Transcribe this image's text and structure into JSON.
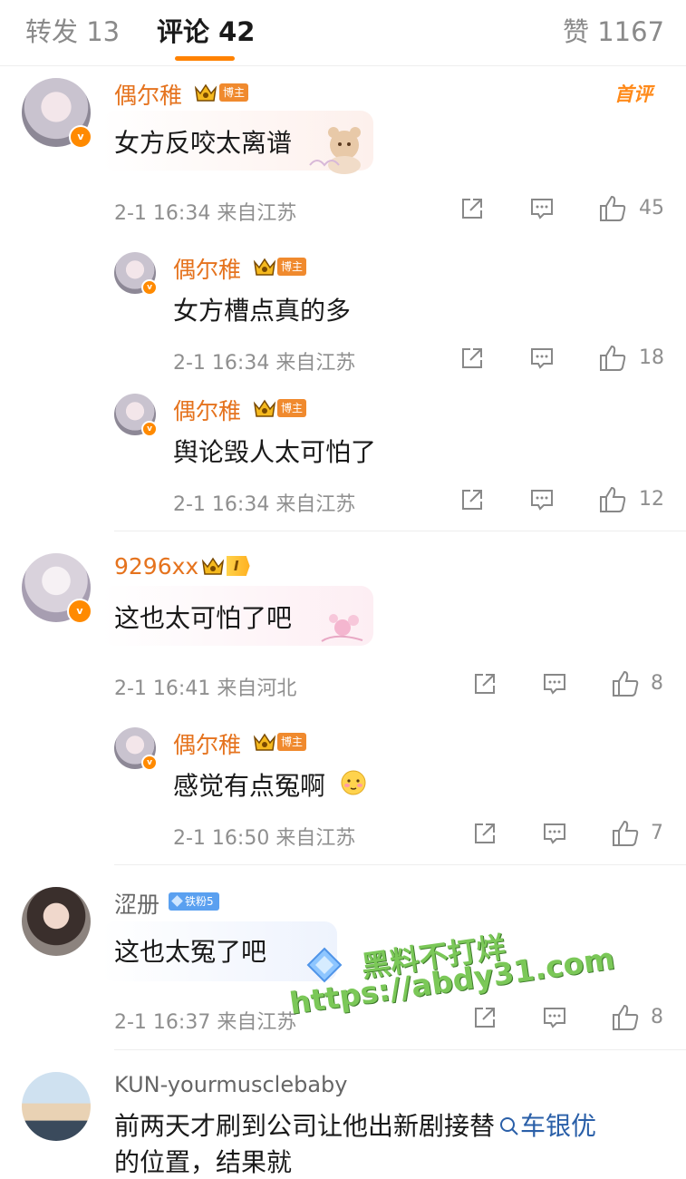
{
  "tabs": {
    "repost": "转发 13",
    "comments": "评论 42",
    "likes": "赞 1167"
  },
  "first_comment_badge": "首评",
  "comments": [
    {
      "user": "偶尔稚",
      "role": "博主",
      "text": "女方反咬太离谱",
      "time": "2-1 16:34 来自江苏",
      "likes": "45",
      "replies": [
        {
          "user": "偶尔稚",
          "role": "博主",
          "text": "女方槽点真的多",
          "time": "2-1 16:34 来自江苏",
          "likes": "18"
        },
        {
          "user": "偶尔稚",
          "role": "博主",
          "text": "舆论毁人太可怕了",
          "time": "2-1 16:34 来自江苏",
          "likes": "12"
        }
      ]
    },
    {
      "user": "9296xx",
      "level": "I",
      "text": "这也太可怕了吧",
      "time": "2-1 16:41 来自河北",
      "likes": "8",
      "replies": [
        {
          "user": "偶尔稚",
          "role": "博主",
          "text": "感觉有点冤啊",
          "time": "2-1 16:50 来自江苏",
          "likes": "7"
        }
      ]
    },
    {
      "user": "涩册",
      "fan_badge": "铁粉5",
      "text": "这也太冤了吧",
      "time": "2-1 16:37 来自江苏",
      "likes": "8"
    },
    {
      "user": "KUN-yourmusclebaby",
      "text_line1": "前两天才刷到公司让他出新剧接替",
      "search_term": "车银优",
      "text_line2": "的位置，结果就"
    }
  ],
  "watermark": {
    "line1": "黑料不打烊",
    "line2": "https://abdy31.com"
  },
  "colors": {
    "accent": "#ff8200",
    "username": "#e5731e",
    "meta_gray": "#8f8f8f"
  }
}
